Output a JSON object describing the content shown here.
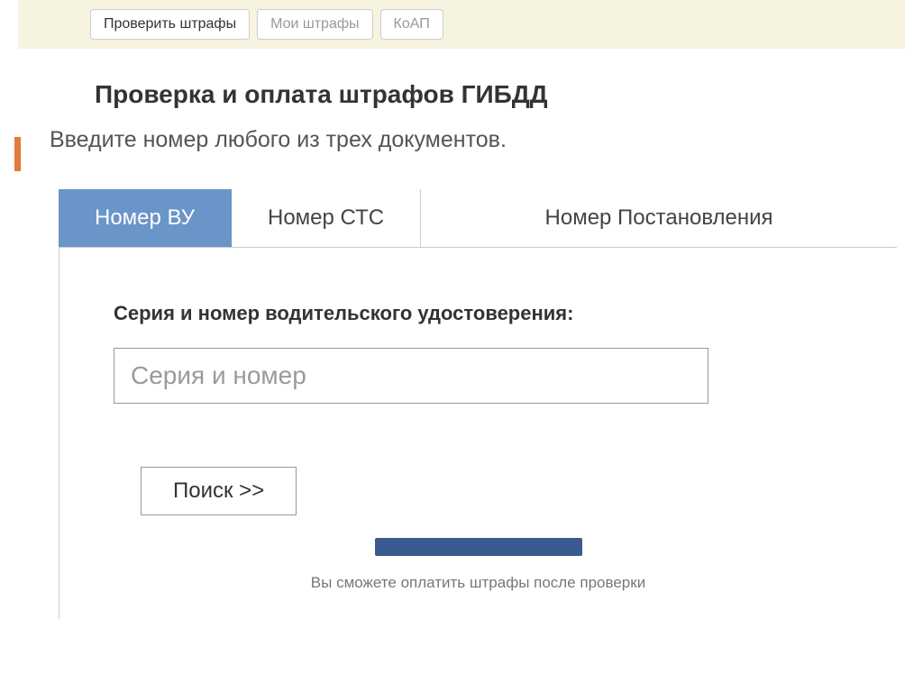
{
  "topnav": {
    "items": [
      {
        "label": "Проверить штрафы"
      },
      {
        "label": "Мои штрафы"
      },
      {
        "label": "КоАП"
      }
    ]
  },
  "page": {
    "title": "Проверка и оплата штрафов ГИБДД",
    "subtitle": "Введите номер любого из трех документов."
  },
  "tabs": [
    {
      "label": "Номер ВУ"
    },
    {
      "label": "Номер СТС"
    },
    {
      "label": "Номер Постановления"
    }
  ],
  "form": {
    "field_label": "Серия и номер водительского удостоверения:",
    "placeholder": "Серия и номер",
    "search_label": "Поиск >>"
  },
  "footer": {
    "note": "Вы сможете оплатить штрафы после проверки"
  }
}
